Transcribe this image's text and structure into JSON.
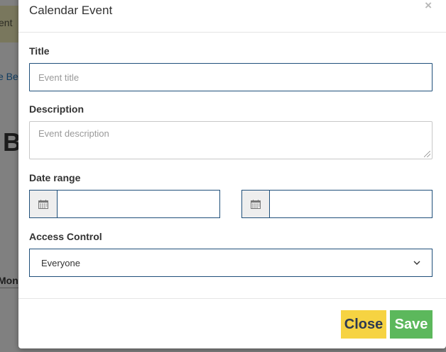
{
  "background": {
    "fragment_text": "ent",
    "link_fragment": "e Be",
    "heading_fragment": "B",
    "day_fragment": "Mon"
  },
  "modal": {
    "title": "Calendar Event",
    "close_symbol": "×"
  },
  "form": {
    "title_label": "Title",
    "title_placeholder": "Event title",
    "description_label": "Description",
    "description_placeholder": "Event description",
    "date_range_label": "Date range",
    "start_date_value": "",
    "end_date_value": "",
    "access_label": "Access Control",
    "access_selected": "Everyone"
  },
  "footer": {
    "close_label": "Close",
    "save_label": "Save"
  },
  "colors": {
    "close_button": "#f6d342",
    "save_button": "#5cb85c",
    "field_border": "#1f4f7a"
  },
  "icons": {
    "date_addon": "calendar-icon",
    "select_arrow": "chevron-down-icon"
  }
}
